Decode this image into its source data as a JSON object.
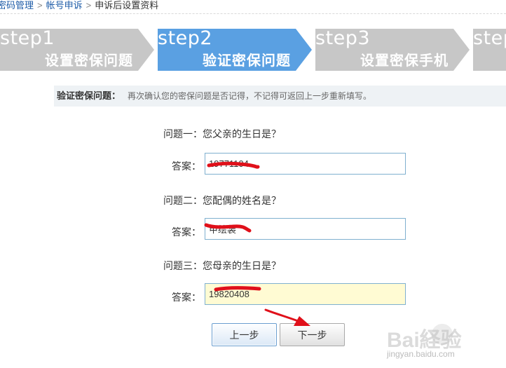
{
  "breadcrumb": {
    "item1": "密码管理",
    "sep1": ">",
    "item2": "帐号申诉",
    "sep2": ">",
    "item3": "申诉后设置资料"
  },
  "steps": [
    {
      "step": "step1",
      "title": "设置密保问题",
      "state": "done",
      "color": "#c7c7c7"
    },
    {
      "step": "step2",
      "title": "验证密保问题",
      "state": "current",
      "color": "#5aa0e2"
    },
    {
      "step": "step3",
      "title": "设置密保手机",
      "state": "pending",
      "color": "#c7c7c7"
    },
    {
      "step": "step",
      "title": "",
      "state": "pending",
      "color": "#c7c7c7"
    }
  ],
  "info": {
    "title": "验证密保问题：",
    "desc": "再次确认您的密保问题是否记得，不记得可返回上一步重新填写。"
  },
  "questions": [
    {
      "label": "问题一：您父亲的生日是？",
      "answer_label": "答案：",
      "answer_value": "19771104"
    },
    {
      "label": "问题二：您配偶的姓名是？",
      "answer_label": "答案：",
      "answer_value": "甲绘装"
    },
    {
      "label": "问题三：您母亲的生日是？",
      "answer_label": "答案：",
      "answer_value": "19820408"
    }
  ],
  "buttons": {
    "prev_label": "上一步",
    "next_label": "下一步"
  },
  "watermark": {
    "logo": "Bai経验",
    "url": "jingyan.baidu.com"
  },
  "colors": {
    "step_active": "#5aa0e2",
    "step_inactive": "#c7c7c7",
    "link": "#1e5ca8",
    "input_border": "#7fb0cf",
    "input_focus_bg": "#fffbd3",
    "annotation_red": "#e0101a"
  }
}
